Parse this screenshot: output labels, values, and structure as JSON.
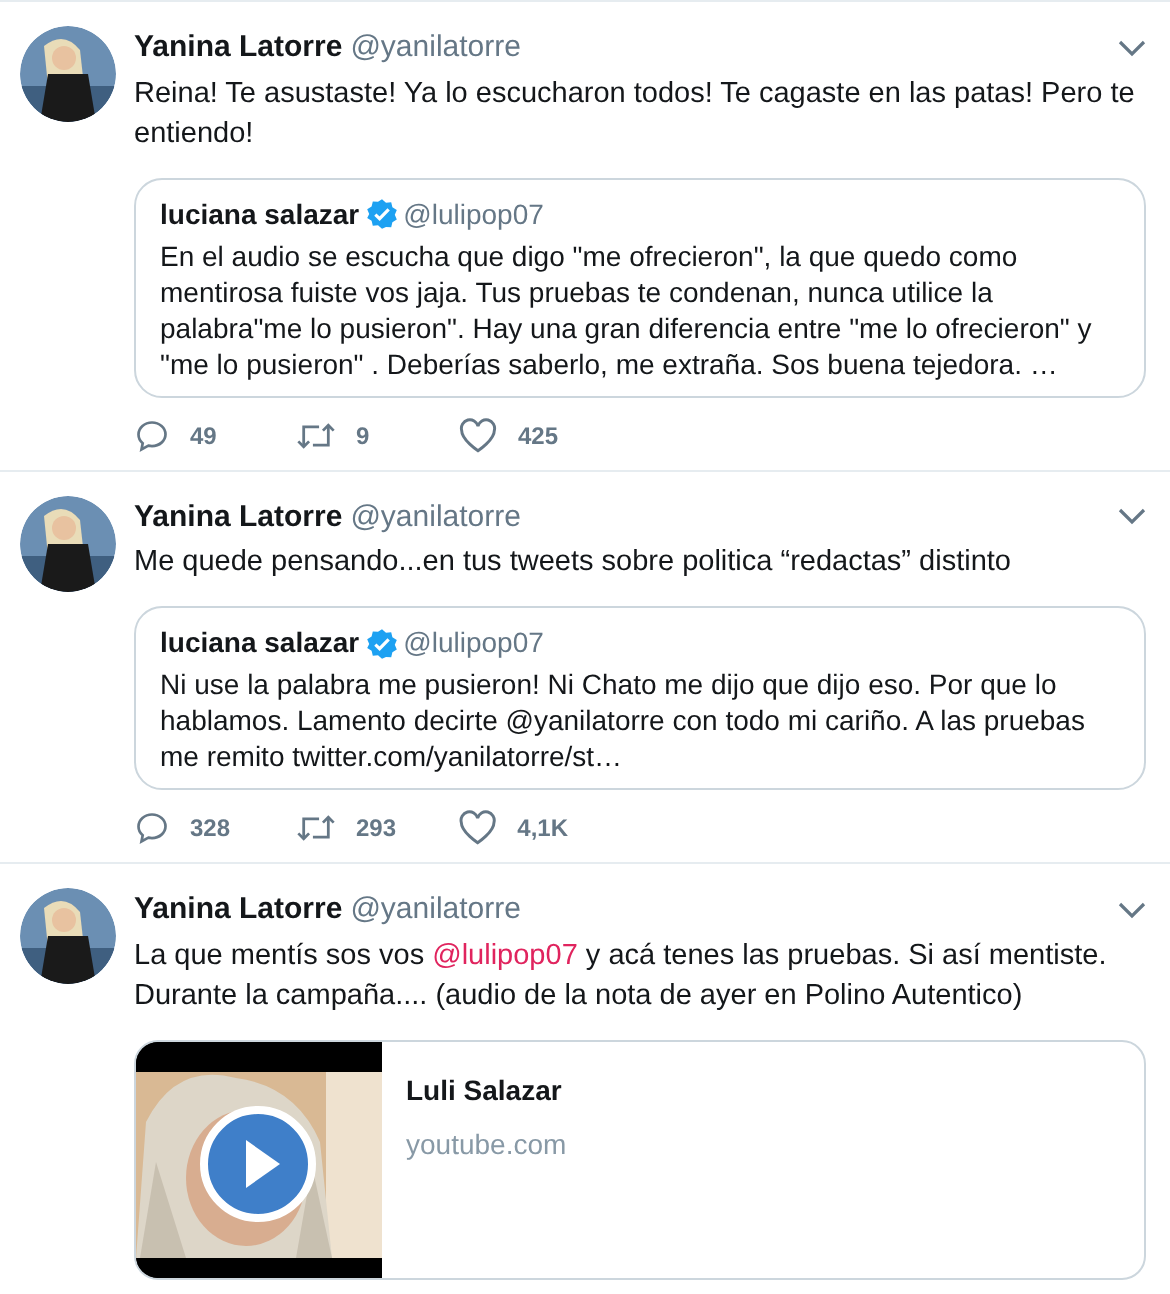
{
  "tweets": [
    {
      "name": "Yanina Latorre",
      "handle": "@yanilatorre",
      "body": [
        {
          "kind": "text",
          "text": "Reina! Te asustaste! Ya lo escucharon todos! Te cagaste en las patas! Pero te entiendo!"
        }
      ],
      "quote": {
        "name": "luciana salazar",
        "verified": true,
        "handle": "@lulipop07",
        "text": "En el audio se escucha que digo \"me ofrecieron\", la que quedo como mentirosa fuiste vos jaja. Tus pruebas te condenan, nunca utilice la palabra\"me lo pusieron\". Hay una gran diferencia entre \"me lo ofrecieron\" y \"me lo pusieron\" . Deberías saberlo, me extraña. Sos buena tejedora. …"
      },
      "replies": "49",
      "retweets": "9",
      "likes": "425"
    },
    {
      "name": "Yanina Latorre",
      "handle": "@yanilatorre",
      "body": [
        {
          "kind": "text",
          "text": "Me quede pensando...en tus tweets sobre politica “redactas” distinto"
        }
      ],
      "quote": {
        "name": "luciana salazar",
        "verified": true,
        "handle": "@lulipop07",
        "text": "Ni use la palabra me pusieron! Ni Chato me dijo que dijo eso. Por que lo hablamos. Lamento decirte @yanilatorre con todo mi cariño. A las pruebas me remito twitter.com/yanilatorre/st…"
      },
      "replies": "328",
      "retweets": "293",
      "likes": "4,1K"
    },
    {
      "name": "Yanina Latorre",
      "handle": "@yanilatorre",
      "body": [
        {
          "kind": "text",
          "text": "La que mentís sos vos "
        },
        {
          "kind": "mention",
          "text": "@lulipop07"
        },
        {
          "kind": "text",
          "text": "  y acá tenes las pruebas. Si así mentiste. Durante la campaña.... (audio de la nota de ayer en Polino Autentico)"
        }
      ],
      "card": {
        "kind": "video",
        "title": "Luli Salazar",
        "domain": "youtube.com"
      }
    }
  ]
}
